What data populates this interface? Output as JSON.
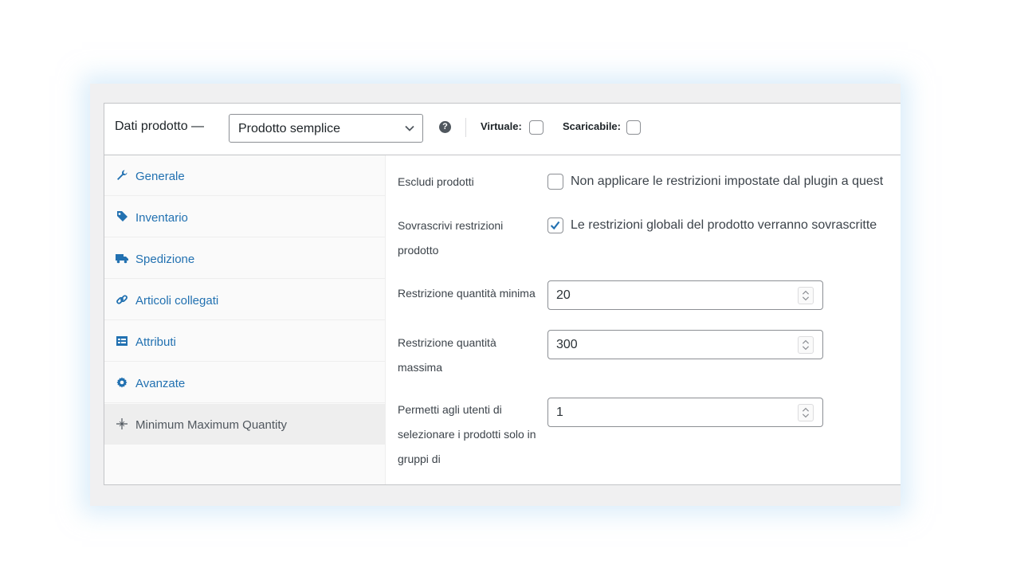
{
  "header": {
    "title": "Dati prodotto —",
    "product_type": "Prodotto semplice",
    "help_icon": "help-icon",
    "virtual_label": "Virtuale:",
    "virtual_checked": false,
    "downloadable_label": "Scaricabile:",
    "downloadable_checked": false
  },
  "tabs": [
    {
      "label": "Generale",
      "icon": "wrench-icon",
      "active": false
    },
    {
      "label": "Inventario",
      "icon": "tag-icon",
      "active": false
    },
    {
      "label": "Spedizione",
      "icon": "truck-icon",
      "active": false
    },
    {
      "label": "Articoli collegati",
      "icon": "link-icon",
      "active": false
    },
    {
      "label": "Attributi",
      "icon": "list-icon",
      "active": false
    },
    {
      "label": "Avanzate",
      "icon": "gear-icon",
      "active": false
    },
    {
      "label": "Minimum Maximum Quantity",
      "icon": "sparkle-icon",
      "active": true
    }
  ],
  "fields": {
    "exclude": {
      "label": "Escludi prodotti",
      "checked": false,
      "text": "Non applicare le restrizioni impostate dal plugin a quest"
    },
    "override": {
      "label_line1": "Sovrascrivi restrizioni",
      "label_line2": "prodotto",
      "checked": true,
      "text": "Le restrizioni globali del prodotto verranno sovrascritte"
    },
    "min_qty": {
      "label": "Restrizione quantità minima",
      "value": "20"
    },
    "max_qty": {
      "label_line1": "Restrizione quantità",
      "label_line2": "massima",
      "value": "300"
    },
    "group_qty": {
      "label_line1": "Permetti agli utenti di",
      "label_line2": "selezionare i prodotti solo in",
      "label_line3": "gruppi di",
      "value": "1"
    }
  },
  "colors": {
    "link": "#2271b1",
    "checkbox_check": "#2271b1",
    "border": "#c3c4c7"
  }
}
